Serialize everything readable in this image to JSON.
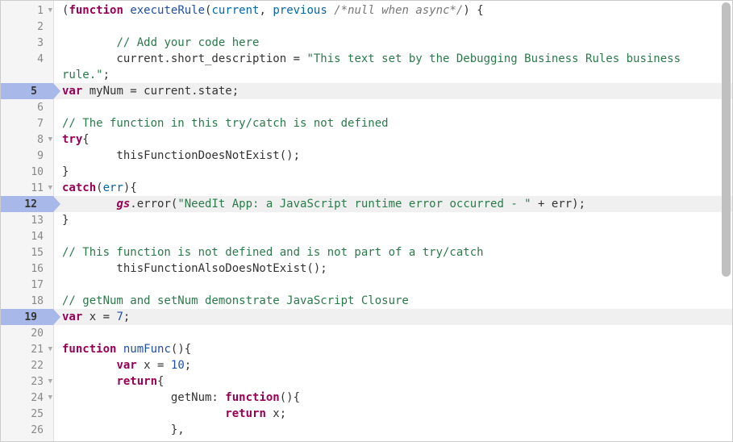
{
  "breakpoints": [
    5,
    12,
    19
  ],
  "foldable": [
    1,
    8,
    11,
    21,
    23,
    24
  ],
  "tokens": {
    "l1": {
      "t1": "(",
      "t2": "function",
      "t3": " ",
      "t4": "executeRule",
      "t5": "(",
      "t6": "current",
      "t7": ", ",
      "t8": "previous",
      "t9": " ",
      "t10": "/*null when async*/",
      "t11": ") {"
    },
    "l3": {
      "t1": "        ",
      "t2": "// Add your code here"
    },
    "l4": {
      "t1": "        current.short_description = ",
      "t2": "\"This text set by the Debugging Business Rules business "
    },
    "l4b": {
      "t1": "rule.\"",
      "t2": ";"
    },
    "l5": {
      "t1": "var",
      "t2": " myNum = current.state;"
    },
    "l7": {
      "t1": "// The function in this try/catch is not defined"
    },
    "l8": {
      "t1": "try",
      "t2": "{"
    },
    "l9": {
      "t1": "        thisFunctionDoesNotExist();"
    },
    "l10": {
      "t1": "}"
    },
    "l11": {
      "t1": "catch",
      "t2": "(",
      "t3": "err",
      "t4": "){"
    },
    "l12": {
      "t1": "        ",
      "t2": "gs",
      "t3": ".error(",
      "t4": "\"NeedIt App: a JavaScript runtime error occurred - \"",
      "t5": " + err);"
    },
    "l13": {
      "t1": "}"
    },
    "l15": {
      "t1": "// This function is not defined and is not part of a try/catch"
    },
    "l16": {
      "t1": "        thisFunctionAlsoDoesNotExist();"
    },
    "l18": {
      "t1": "// getNum and setNum demonstrate JavaScript Closure"
    },
    "l19": {
      "t1": "var",
      "t2": " x = ",
      "t3": "7",
      "t4": ";"
    },
    "l21": {
      "t1": "function",
      "t2": " ",
      "t3": "numFunc",
      "t4": "(){"
    },
    "l22": {
      "t1": "        ",
      "t2": "var",
      "t3": " x = ",
      "t4": "10",
      "t5": ";"
    },
    "l23": {
      "t1": "        ",
      "t2": "return",
      "t3": "{"
    },
    "l24": {
      "t1": "                getNum: ",
      "t2": "function",
      "t3": "(){"
    },
    "l25": {
      "t1": "                        ",
      "t2": "return",
      "t3": " x;"
    },
    "l26": {
      "t1": "                },"
    }
  },
  "lineCount": 26
}
